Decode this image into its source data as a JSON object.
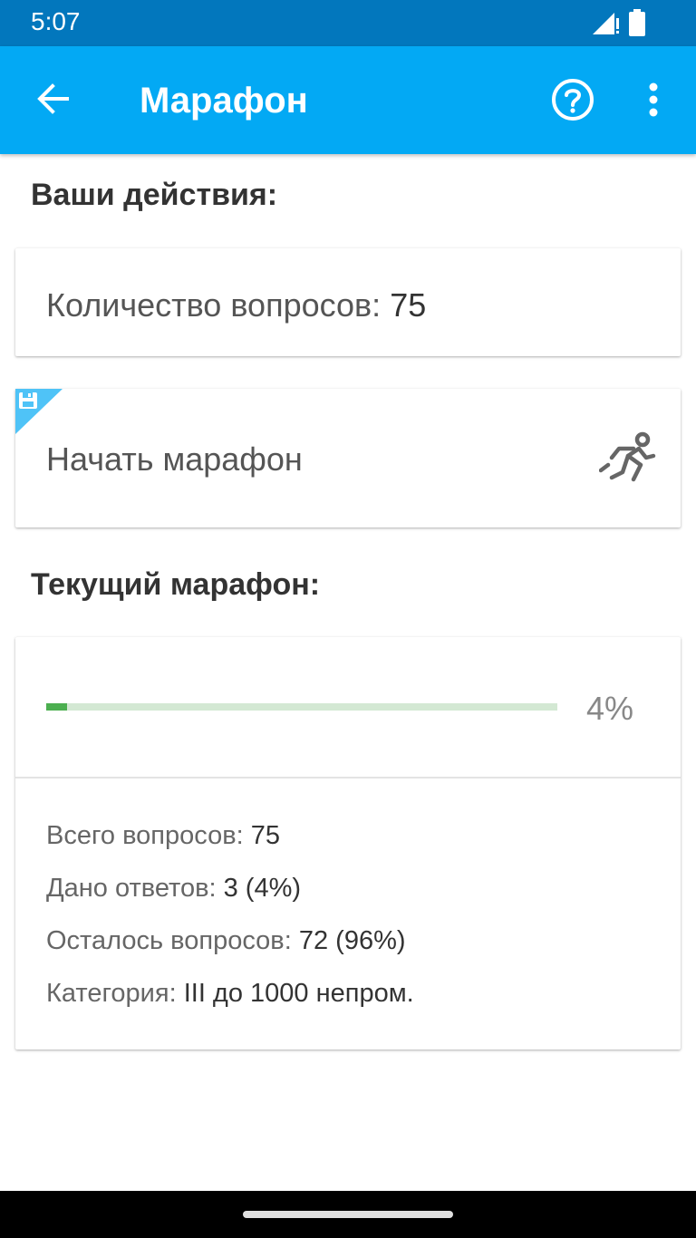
{
  "status_bar": {
    "time": "5:07",
    "icons": [
      "signal-icon",
      "battery-icon"
    ]
  },
  "app_bar": {
    "title": "Марафон",
    "back_icon": "arrow-back-icon",
    "help_icon": "help-circle-icon",
    "more_icon": "more-vert-icon"
  },
  "actions": {
    "heading": "Ваши действия:",
    "question_count_label": "Количество вопросов:",
    "question_count_value": "75",
    "start_label": "Начать марафон",
    "start_icon": "runner-icon",
    "save_badge_icon": "floppy-save-icon"
  },
  "current": {
    "heading": "Текущий марафон:",
    "progress_fraction": 0.04,
    "progress_label": "4%",
    "total_label": "Всего вопросов:",
    "total_value": "75",
    "answered_label": "Дано ответов:",
    "answered_value": "3 (4%)",
    "remaining_label": "Осталось вопросов:",
    "remaining_value": "72 (96%)",
    "category_label": "Категория:",
    "category_value": "III до 1000 непром."
  },
  "colors": {
    "status_bar": "#0277bd",
    "app_bar": "#03a9f4",
    "progress_fill": "#4caf50",
    "progress_track": "#d3e8d3",
    "badge": "#4fc3f7"
  }
}
